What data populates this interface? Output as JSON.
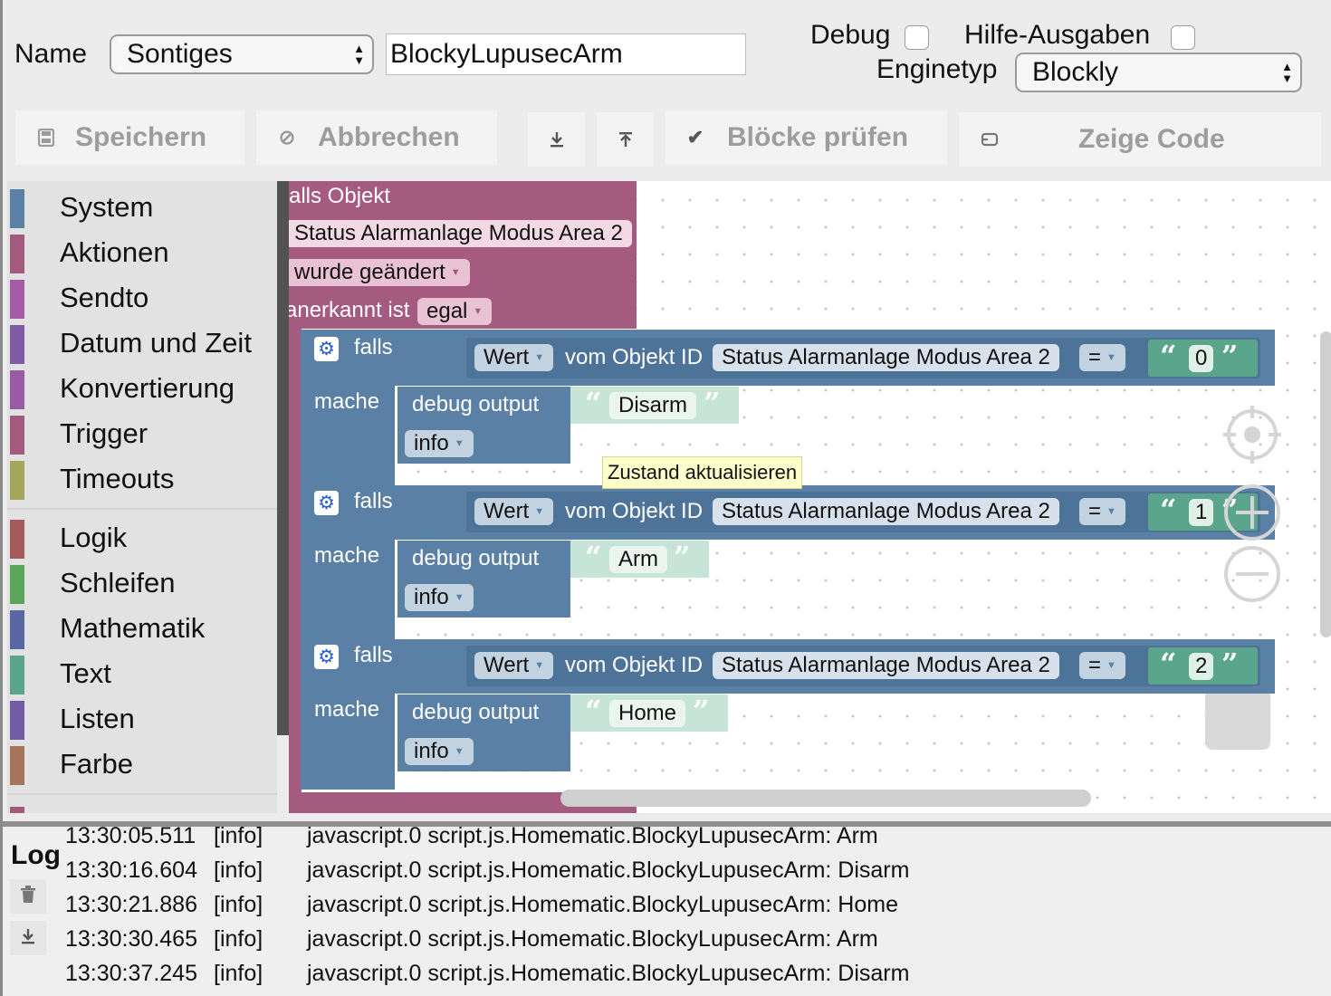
{
  "header": {
    "name_label": "Name",
    "folder_value": "Sontiges",
    "script_name": "BlockyLupusecArm",
    "debug_label": "Debug",
    "help_label": "Hilfe-Ausgaben",
    "engine_label": "Enginetyp",
    "engine_value": "Blockly"
  },
  "toolbar": {
    "save_label": "Speichern",
    "cancel_label": "Abbrechen",
    "check_label": "Blöcke prüfen",
    "code_label": "Zeige Code"
  },
  "toolbox": {
    "categories": [
      {
        "label": "System",
        "color": "#5b80a5"
      },
      {
        "label": "Aktionen",
        "color": "#a55b80"
      },
      {
        "label": "Sendto",
        "color": "#a55ba5"
      },
      {
        "label": "Datum und Zeit",
        "color": "#805ba5"
      },
      {
        "label": "Konvertierung",
        "color": "#995ba5"
      },
      {
        "label": "Trigger",
        "color": "#a55b80"
      },
      {
        "label": "Timeouts",
        "color": "#a5a55b"
      },
      {
        "label": "Logik",
        "color": "#a55b5b"
      },
      {
        "label": "Schleifen",
        "color": "#5ba55b"
      },
      {
        "label": "Mathematik",
        "color": "#5b67a5"
      },
      {
        "label": "Text",
        "color": "#5ba58c"
      },
      {
        "label": "Listen",
        "color": "#745ba5"
      },
      {
        "label": "Farbe",
        "color": "#a5745b"
      }
    ]
  },
  "workspace": {
    "trigger": {
      "line1": "alls Objekt",
      "object": "Status Alarmanlage Modus Area 2",
      "changed": "wurde geändert",
      "ack_label": "anerkannt ist",
      "ack_value": "egal"
    },
    "if_label": "falls",
    "do_label": "mache",
    "value_label": "Wert",
    "from_label": "vom Objekt ID",
    "op": "=",
    "debug_label": "debug output",
    "level": "info",
    "tooltip": "Zustand aktualisieren",
    "ifs": [
      {
        "object": "Status Alarmanlage Modus Area 2",
        "compare": "0",
        "output": "Disarm"
      },
      {
        "object": "Status Alarmanlage Modus Area 2",
        "compare": "1",
        "output": "Arm"
      },
      {
        "object": "Status Alarmanlage Modus Area 2",
        "compare": "2",
        "output": "Home"
      }
    ]
  },
  "log": {
    "title": "Log",
    "rows": [
      {
        "time": "13:30:05.511",
        "sev": "[info]",
        "msg": "javascript.0 script.js.Homematic.BlockyLupusecArm: Arm"
      },
      {
        "time": "13:30:16.604",
        "sev": "[info]",
        "msg": "javascript.0 script.js.Homematic.BlockyLupusecArm: Disarm"
      },
      {
        "time": "13:30:21.886",
        "sev": "[info]",
        "msg": "javascript.0 script.js.Homematic.BlockyLupusecArm: Home"
      },
      {
        "time": "13:30:30.465",
        "sev": "[info]",
        "msg": "javascript.0 script.js.Homematic.BlockyLupusecArm: Arm"
      },
      {
        "time": "13:30:37.245",
        "sev": "[info]",
        "msg": "javascript.0 script.js.Homematic.BlockyLupusecArm: Disarm"
      }
    ]
  }
}
